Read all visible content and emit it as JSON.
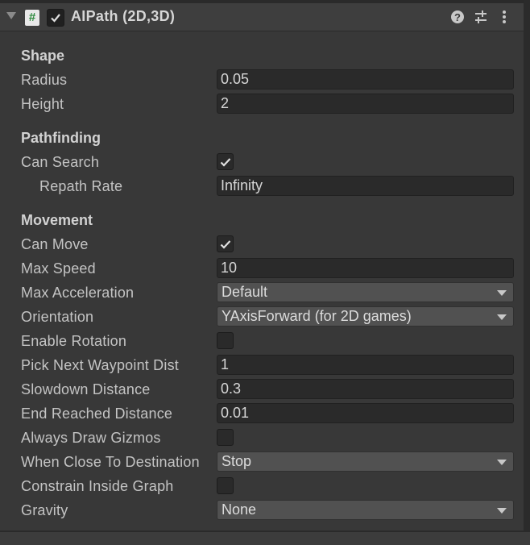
{
  "component": {
    "title": "AIPath (2D,3D)",
    "enabled": true,
    "script_icon": "#",
    "header_icons": [
      "help-icon",
      "presets-icon",
      "kebab-menu-icon"
    ]
  },
  "sections": {
    "shape": "Shape",
    "pathfinding": "Pathfinding",
    "movement": "Movement"
  },
  "fields": {
    "radius": {
      "label": "Radius",
      "value": "0.05"
    },
    "height": {
      "label": "Height",
      "value": "2"
    },
    "can_search": {
      "label": "Can Search",
      "checked": true
    },
    "repath_rate": {
      "label": "Repath Rate",
      "value": "Infinity"
    },
    "can_move": {
      "label": "Can Move",
      "checked": true
    },
    "max_speed": {
      "label": "Max Speed",
      "value": "10"
    },
    "max_acceleration": {
      "label": "Max Acceleration",
      "value": "Default"
    },
    "orientation": {
      "label": "Orientation",
      "value": "YAxisForward (for 2D games)"
    },
    "enable_rotation": {
      "label": "Enable Rotation",
      "checked": false
    },
    "pick_next_waypoint_dist": {
      "label": "Pick Next Waypoint Dist",
      "value": "1"
    },
    "slowdown_distance": {
      "label": "Slowdown Distance",
      "value": "0.3"
    },
    "end_reached_distance": {
      "label": "End Reached Distance",
      "value": "0.01"
    },
    "always_draw_gizmos": {
      "label": "Always Draw Gizmos",
      "checked": false
    },
    "when_close_to_destination": {
      "label": "When Close To Destination",
      "value": "Stop"
    },
    "constrain_inside_graph": {
      "label": "Constrain Inside Graph",
      "checked": false
    },
    "gravity": {
      "label": "Gravity",
      "value": "None"
    }
  },
  "colors": {
    "background": "#383838",
    "field_bg": "#2a2a2a",
    "dropdown_bg": "#515151",
    "script_icon_green": "#2e8b3e"
  }
}
